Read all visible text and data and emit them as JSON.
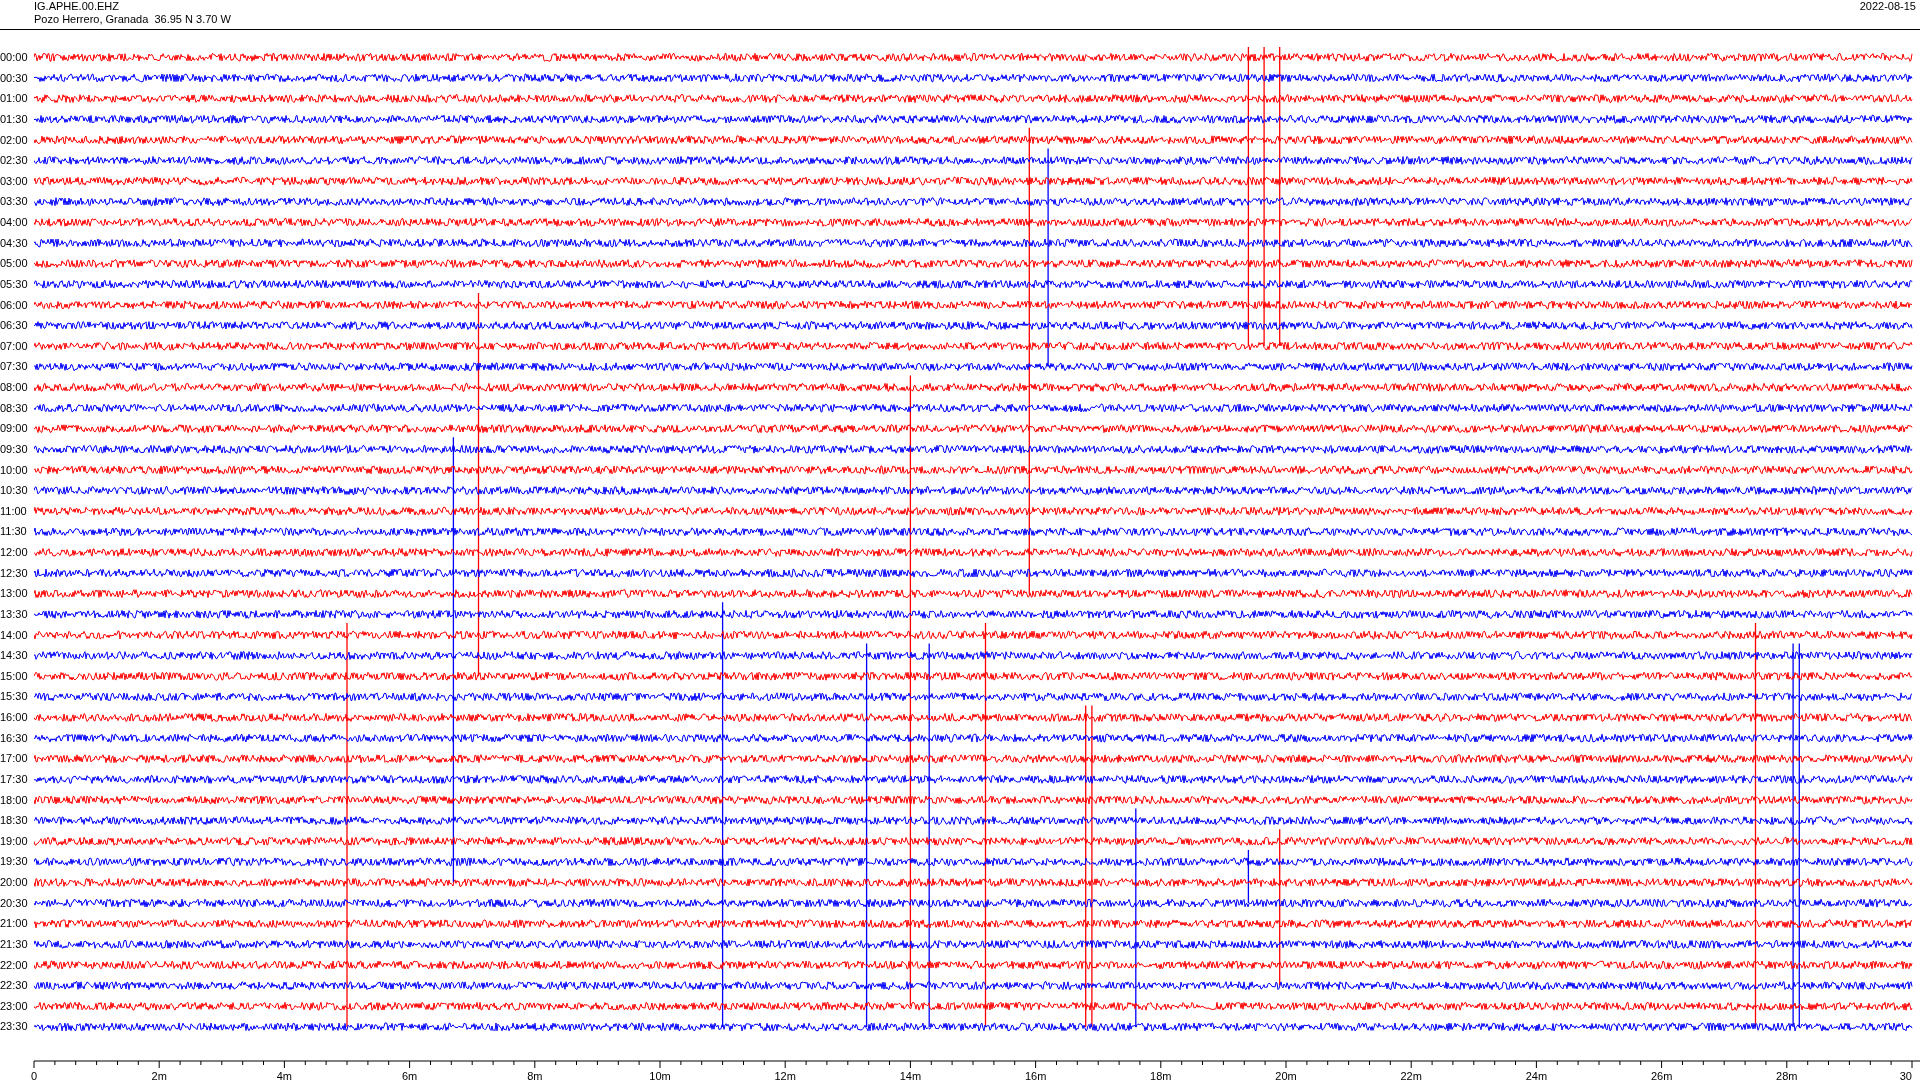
{
  "header": {
    "station": "IG.APHE.00.EHZ",
    "location": "Pozo Herrero, Granada  36.95 N 3.70 W",
    "date": "2022-08-15"
  },
  "rows": [
    {
      "time": "00:00",
      "color": "#ff0000"
    },
    {
      "time": "00:30",
      "color": "#0000ff"
    },
    {
      "time": "01:00",
      "color": "#ff0000"
    },
    {
      "time": "01:30",
      "color": "#0000ff"
    },
    {
      "time": "02:00",
      "color": "#ff0000"
    },
    {
      "time": "02:30",
      "color": "#0000ff"
    },
    {
      "time": "03:00",
      "color": "#ff0000"
    },
    {
      "time": "03:30",
      "color": "#0000ff"
    },
    {
      "time": "04:00",
      "color": "#ff0000"
    },
    {
      "time": "04:30",
      "color": "#0000ff"
    },
    {
      "time": "05:00",
      "color": "#ff0000"
    },
    {
      "time": "05:30",
      "color": "#0000ff"
    },
    {
      "time": "06:00",
      "color": "#ff0000"
    },
    {
      "time": "06:30",
      "color": "#0000ff"
    },
    {
      "time": "07:00",
      "color": "#ff0000"
    },
    {
      "time": "07:30",
      "color": "#0000ff"
    },
    {
      "time": "08:00",
      "color": "#ff0000"
    },
    {
      "time": "08:30",
      "color": "#0000ff"
    },
    {
      "time": "09:00",
      "color": "#ff0000"
    },
    {
      "time": "09:30",
      "color": "#0000ff"
    },
    {
      "time": "10:00",
      "color": "#ff0000"
    },
    {
      "time": "10:30",
      "color": "#0000ff"
    },
    {
      "time": "11:00",
      "color": "#ff0000"
    },
    {
      "time": "11:30",
      "color": "#0000ff"
    },
    {
      "time": "12:00",
      "color": "#ff0000"
    },
    {
      "time": "12:30",
      "color": "#0000ff"
    },
    {
      "time": "13:00",
      "color": "#ff0000"
    },
    {
      "time": "13:30",
      "color": "#0000ff"
    },
    {
      "time": "14:00",
      "color": "#ff0000"
    },
    {
      "time": "14:30",
      "color": "#0000ff"
    },
    {
      "time": "15:00",
      "color": "#ff0000"
    },
    {
      "time": "15:30",
      "color": "#0000ff"
    },
    {
      "time": "16:00",
      "color": "#ff0000"
    },
    {
      "time": "16:30",
      "color": "#0000ff"
    },
    {
      "time": "17:00",
      "color": "#ff0000"
    },
    {
      "time": "17:30",
      "color": "#0000ff"
    },
    {
      "time": "18:00",
      "color": "#ff0000"
    },
    {
      "time": "18:30",
      "color": "#0000ff"
    },
    {
      "time": "19:00",
      "color": "#ff0000"
    },
    {
      "time": "19:30",
      "color": "#0000ff"
    },
    {
      "time": "20:00",
      "color": "#ff0000"
    },
    {
      "time": "20:30",
      "color": "#0000ff"
    },
    {
      "time": "21:00",
      "color": "#ff0000"
    },
    {
      "time": "21:30",
      "color": "#0000ff"
    },
    {
      "time": "22:00",
      "color": "#ff0000"
    },
    {
      "time": "22:30",
      "color": "#0000ff"
    },
    {
      "time": "23:00",
      "color": "#ff0000"
    },
    {
      "time": "23:30",
      "color": "#0000ff"
    }
  ],
  "x_axis": {
    "ticks": [
      "0",
      "2m",
      "4m",
      "6m",
      "8m",
      "10m",
      "12m",
      "14m",
      "16m",
      "18m",
      "20m",
      "22m",
      "24m",
      "26m",
      "28m",
      "30"
    ]
  }
}
